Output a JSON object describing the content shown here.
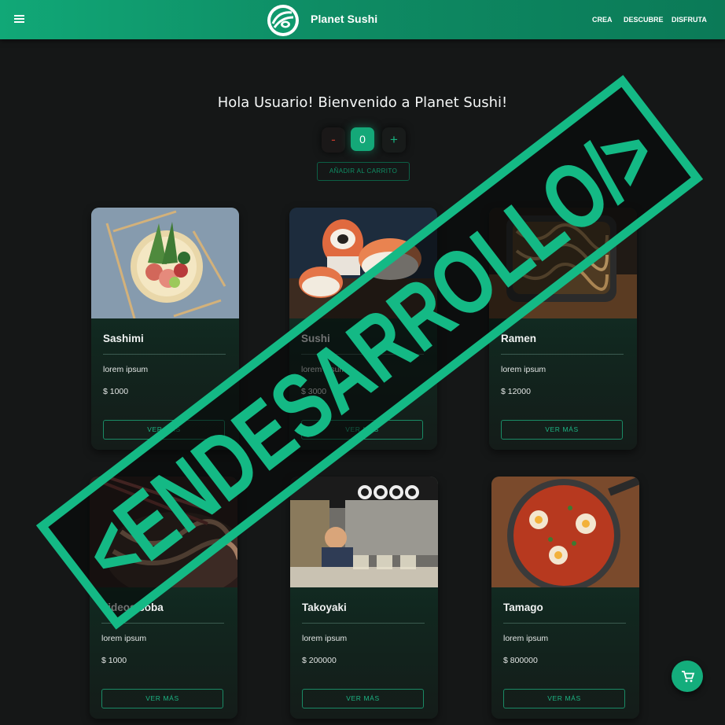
{
  "navbar": {
    "brand": "Planet Sushi",
    "links": [
      "CREA",
      "DESCUBRE",
      "DISFRUTA"
    ]
  },
  "hero": {
    "welcome": "Hola Usuario! Bienvenido a Planet Sushi!",
    "minus_label": "-",
    "plus_label": "+",
    "quantity": "0",
    "add_to_cart_label": "AÑADIR AL CARRITO"
  },
  "products": [
    {
      "name": "Sashimi",
      "desc": "lorem ipsum",
      "price": "$ 1000",
      "button": "VER MÁS"
    },
    {
      "name": "Sushi",
      "desc": "lorem ipsum",
      "price": "$ 3000",
      "button": "VER MÁS"
    },
    {
      "name": "Ramen",
      "desc": "lorem ipsum",
      "price": "$ 12000",
      "button": "VER MÁS"
    },
    {
      "name": "Fideos soba",
      "desc": "lorem ipsum",
      "price": "$ 1000",
      "button": "VER MÁS"
    },
    {
      "name": "Takoyaki",
      "desc": "lorem ipsum",
      "price": "$ 200000",
      "button": "VER MÁS"
    },
    {
      "name": "Tamago",
      "desc": "lorem ipsum",
      "price": "$ 800000",
      "button": "VER MÁS"
    }
  ],
  "overlay": {
    "stamp_text": "<ENDESARROLLO/>"
  },
  "icons": {
    "menu": "hamburger-menu-icon",
    "logo": "planet-sushi-logo",
    "cart": "shopping-cart-icon"
  },
  "colors": {
    "accent": "#14ad7c",
    "background": "#151717",
    "minus": "#c0392b"
  }
}
